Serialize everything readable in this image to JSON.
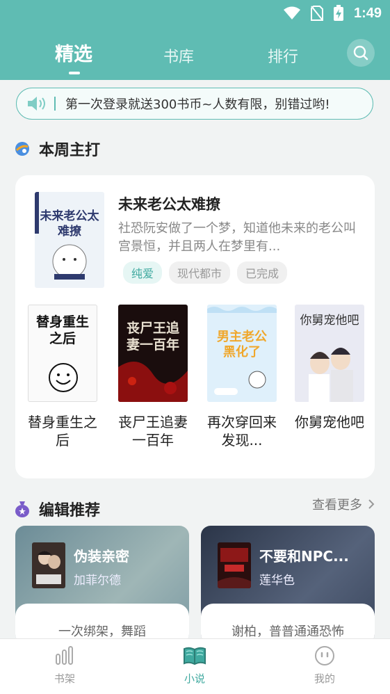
{
  "status": {
    "time": "1:49"
  },
  "tabs": [
    {
      "label": "精选",
      "active": true
    },
    {
      "label": "书库",
      "active": false
    },
    {
      "label": "排行",
      "active": false
    }
  ],
  "notice": {
    "text": "第一次登录就送300书币~人数有限，别错过哟!"
  },
  "weekly": {
    "title": "本周主打",
    "featured": {
      "title": "未来老公太难撩",
      "desc": "社恐阮安做了一个梦，知道他未来的老公叫宫景恒，并且两人在梦里有...",
      "cover_text": "未来老公太难撩",
      "tags": [
        "纯爱",
        "现代都市",
        "已完成"
      ]
    },
    "books": [
      {
        "title": "替身重生之后",
        "cover_text": "替身重生之后"
      },
      {
        "title": "丧尸王追妻一百年",
        "cover_text": "丧尸王追妻一百年"
      },
      {
        "title": "再次穿回来发现...",
        "cover_text": "男主老公黑化了"
      },
      {
        "title": "你舅宠他吧",
        "cover_text": "你舅宠他吧"
      }
    ]
  },
  "editor": {
    "title": "编辑推荐",
    "more_label": "查看更多",
    "items": [
      {
        "title": "伪装亲密",
        "author": "加菲尔德",
        "desc": "一次绑架，舞蹈"
      },
      {
        "title": "不要和NPC...",
        "author": "莲华色",
        "desc": "谢柏，普普通通恐怖"
      }
    ]
  },
  "bottom_nav": [
    {
      "label": "书架",
      "icon": "bookshelf-icon",
      "active": false
    },
    {
      "label": "小说",
      "icon": "book-open-icon",
      "active": true
    },
    {
      "label": "我的",
      "icon": "profile-icon",
      "active": false
    }
  ],
  "colors": {
    "accent": "#5fbcb3",
    "accent_dark": "#3fa99f"
  }
}
